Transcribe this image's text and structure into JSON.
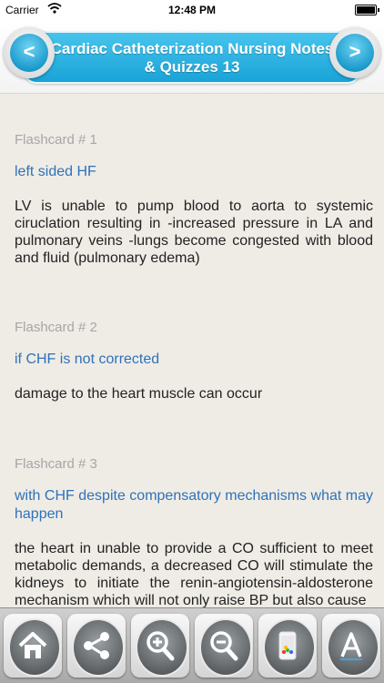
{
  "status_bar": {
    "carrier": "Carrier",
    "time": "12:48 PM"
  },
  "header": {
    "title": "Cardiac Catheterization Nursing  Notes & Quizzes 13",
    "prev_icon": "<",
    "next_icon": ">"
  },
  "flashcards": [
    {
      "number": "Flashcard # 1",
      "question": "left sided HF",
      "answer": "LV is unable to pump blood to aorta to systemic ciruclation resulting in -increased pressure in LA and pulmonary veins -lungs become congested with blood and fluid (pulmonary edema)"
    },
    {
      "number": "Flashcard # 2",
      "question": "if CHF is not corrected",
      "answer": "damage to the heart muscle can occur"
    },
    {
      "number": "Flashcard # 3",
      "question": "with CHF despite compensatory mechanisms what may happen",
      "answer": "the heart in unable to provide a CO sufficient to meet metabolic demands, a decreased CO will stimulate the kidneys to initiate the renin-angiotensin-aldosterone mechanism which will not only raise BP but also cause"
    }
  ],
  "toolbar": {
    "items": [
      "home-icon",
      "share-icon",
      "zoom-in-icon",
      "zoom-out-icon",
      "color-palette-icon",
      "font-icon"
    ]
  },
  "colors": {
    "accent": "#1fa8dc",
    "question_text": "#2f72b8",
    "card_number": "#a6a6a6",
    "background": "#efece6"
  }
}
